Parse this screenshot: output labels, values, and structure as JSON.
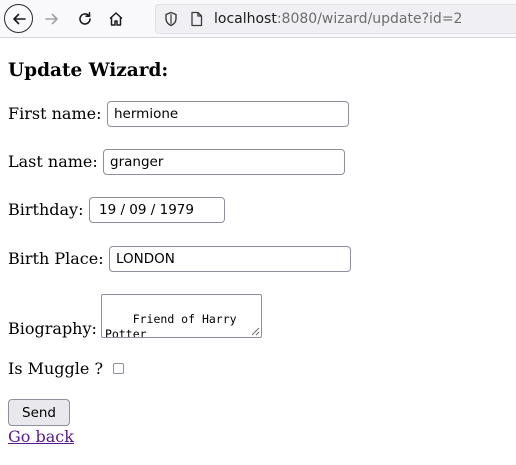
{
  "browser": {
    "url_host": "localhost",
    "url_rest": ":8080/wizard/update?id=2",
    "icons": [
      "back-arrow-icon",
      "forward-arrow-icon",
      "reload-icon",
      "home-icon",
      "shield-icon",
      "page-icon"
    ]
  },
  "form": {
    "title": "Update Wizard:",
    "first_name_label": "First name:",
    "first_name_value": "hermione",
    "last_name_label": "Last name:",
    "last_name_value": "granger",
    "birthday_label": "Birthday:",
    "birthday_value": "19 / 09 / 1979",
    "birth_place_label": "Birth Place:",
    "birth_place_value": "LONDON",
    "biography_label": "Biography:",
    "biography_value": "Friend of Harry Potter",
    "muggle_label": "Is Muggle ?",
    "muggle_checked": false,
    "send_label": "Send",
    "back_link": "Go back"
  },
  "colors": {
    "toolbar_bg": "#f9f9fb",
    "urlbar_bg": "#f0f0f4",
    "visited_link": "#551a8b",
    "button_bg": "#e9e9ed"
  }
}
